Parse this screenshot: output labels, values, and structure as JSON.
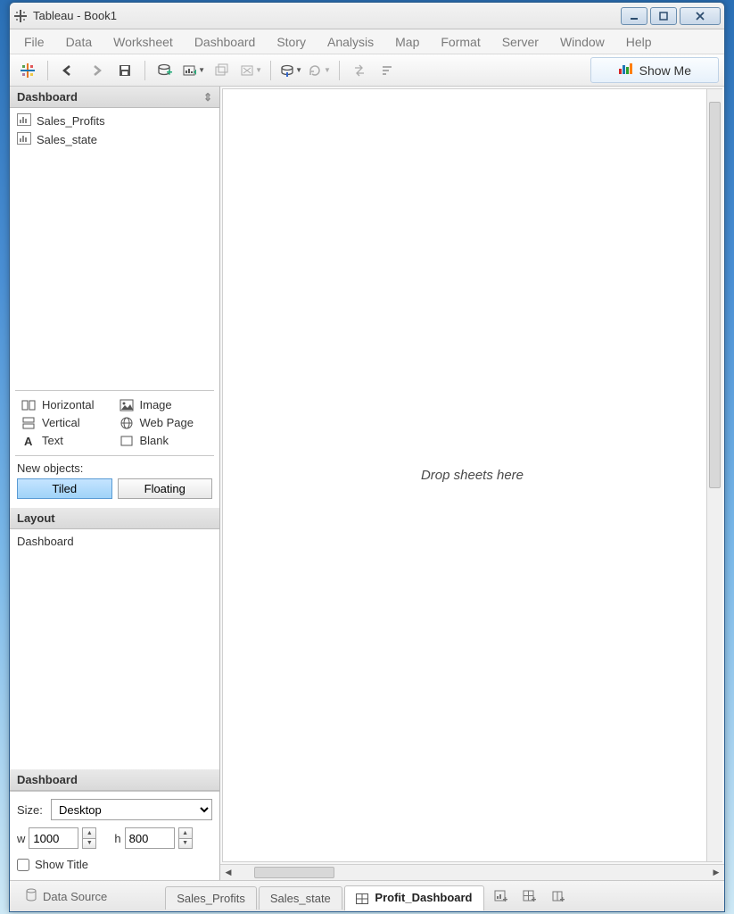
{
  "titlebar": {
    "title": "Tableau - Book1"
  },
  "menu": [
    "File",
    "Data",
    "Worksheet",
    "Dashboard",
    "Story",
    "Analysis",
    "Map",
    "Format",
    "Server",
    "Window",
    "Help"
  ],
  "toolbar": {
    "showme": "Show Me"
  },
  "sidebar": {
    "dashboard_header": "Dashboard",
    "sheets": [
      {
        "name": "Sales_Profits"
      },
      {
        "name": "Sales_state"
      }
    ],
    "objects": {
      "horizontal": "Horizontal",
      "image": "Image",
      "vertical": "Vertical",
      "webpage": "Web Page",
      "text": "Text",
      "blank": "Blank"
    },
    "new_objects_label": "New objects:",
    "tiled": "Tiled",
    "floating": "Floating",
    "layout_header": "Layout",
    "layout_item": "Dashboard",
    "dashboard2_header": "Dashboard",
    "size_label": "Size:",
    "size_value": "Desktop",
    "w_label": "w",
    "w_value": "1000",
    "h_label": "h",
    "h_value": "800",
    "show_title": "Show Title"
  },
  "canvas": {
    "placeholder": "Drop sheets here"
  },
  "bottom": {
    "data_source": "Data Source",
    "tabs": [
      {
        "label": "Sales_Profits",
        "type": "sheet",
        "active": false
      },
      {
        "label": "Sales_state",
        "type": "sheet",
        "active": false
      },
      {
        "label": "Profit_Dashboard",
        "type": "dashboard",
        "active": true
      }
    ]
  }
}
